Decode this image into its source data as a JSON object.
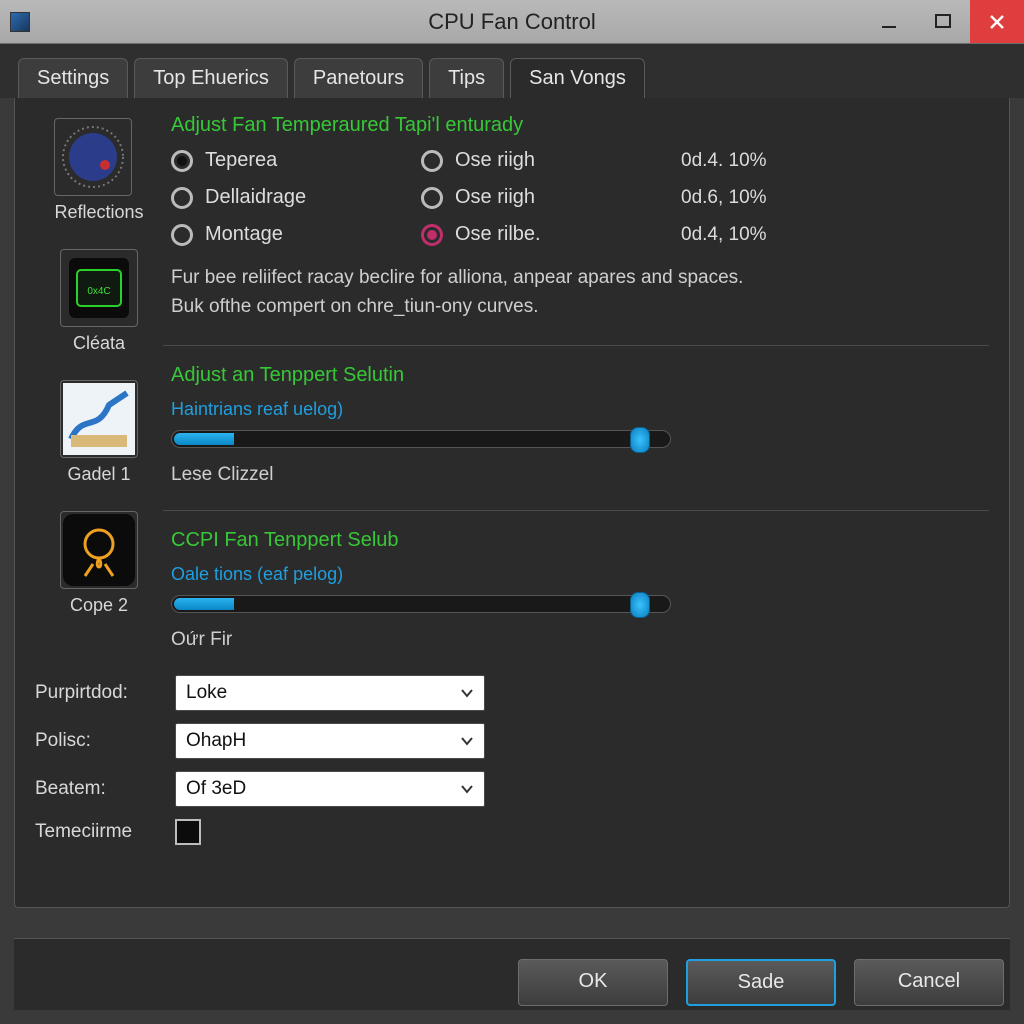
{
  "window": {
    "title": "CPU Fan Control"
  },
  "tabs": [
    {
      "label": "Settings"
    },
    {
      "label": "Top Ehuerics"
    },
    {
      "label": "Panetours"
    },
    {
      "label": "Tips"
    },
    {
      "label": "San Vongs"
    }
  ],
  "sidebar": [
    {
      "label": "Reflections"
    },
    {
      "label": "Cléata"
    },
    {
      "label": "Gadel 1"
    },
    {
      "label": "Cope 2"
    }
  ],
  "section1": {
    "title": "Adjust Fan Temperaured Tapi'l enturady",
    "left": [
      {
        "label": "Teperea",
        "state": "selected"
      },
      {
        "label": "Dellaidrage",
        "state": ""
      },
      {
        "label": "Montage",
        "state": ""
      }
    ],
    "right": [
      {
        "label": "Ose riigh",
        "value": "0d.4. 10%",
        "variant": ""
      },
      {
        "label": "Ose riigh",
        "value": "0d.6, 10%",
        "variant": ""
      },
      {
        "label": "Ose rilbe.",
        "value": "0d.4, 10%",
        "variant": "magenta"
      }
    ],
    "desc1": "Fur bee reliifect racay beclire for alliona, anpear apares and spaces.",
    "desc2": "Buk ofthe compert on chre_tiun-ony curves."
  },
  "section2": {
    "title": "Adjust an Tenppert Selutin",
    "slider_label": "Haintrians reaf uelog)",
    "caption": "Lese Clizzel",
    "slider_percent": 94
  },
  "section3": {
    "title": "CCPI Fan Tenppert Selub",
    "slider_label": "Oale tions (eaf pelog)",
    "caption": "Oứr Fir",
    "slider_percent": 94
  },
  "form": {
    "rows": [
      {
        "label": "Purpirtdod:",
        "value": "Loke"
      },
      {
        "label": "Polisc:",
        "value": "OhapH"
      },
      {
        "label": "Beatem:",
        "value": "Of 3eD"
      }
    ],
    "checkbox_label": "Temeciirme"
  },
  "buttons": {
    "ok": "OK",
    "sade": "Sade",
    "cancel": "Cancel"
  }
}
